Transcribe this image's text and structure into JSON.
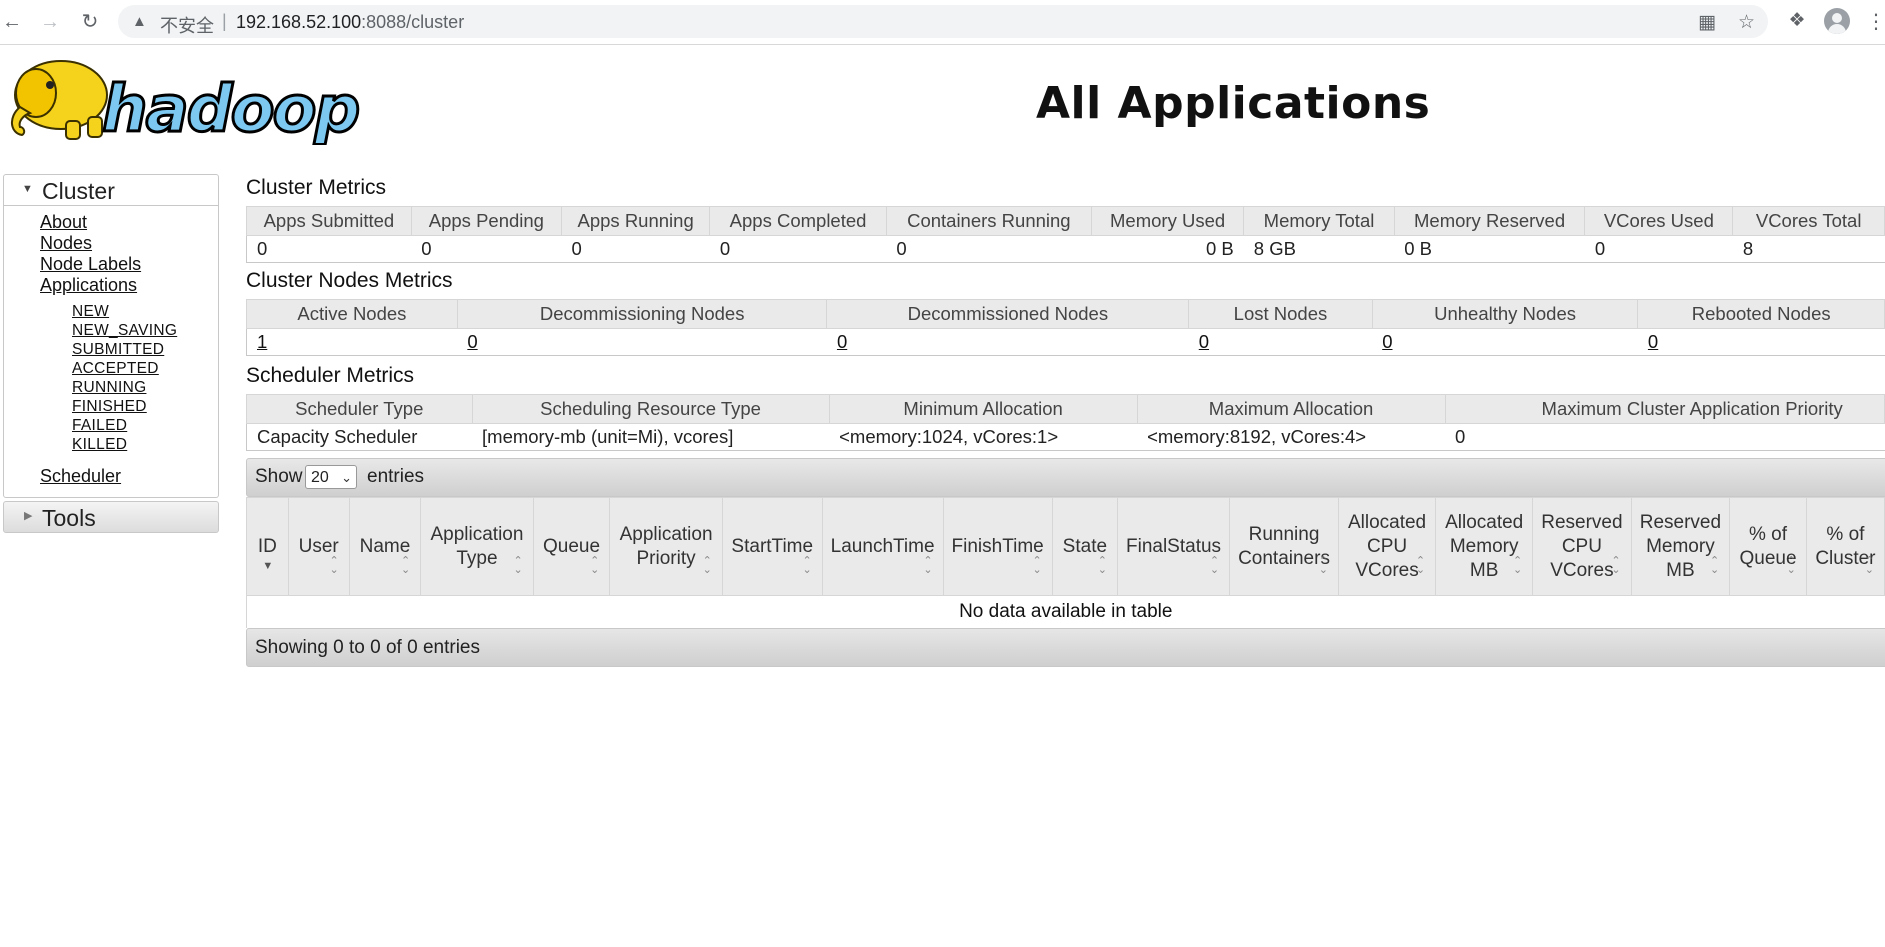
{
  "browser": {
    "insecure_label": "不安全",
    "url_host": "192.168.52.100",
    "url_rest": ":8088/cluster"
  },
  "header": {
    "logo_text": "hadoop",
    "title": "All Applications"
  },
  "sidebar": {
    "cluster_label": "Cluster",
    "links": [
      "About",
      "Nodes",
      "Node Labels",
      "Applications"
    ],
    "app_states": [
      "NEW",
      "NEW_SAVING",
      "SUBMITTED",
      "ACCEPTED",
      "RUNNING",
      "FINISHED",
      "FAILED",
      "KILLED"
    ],
    "scheduler_label": "Scheduler",
    "tools_label": "Tools"
  },
  "cluster_metrics": {
    "title": "Cluster Metrics",
    "headers": [
      "Apps Submitted",
      "Apps Pending",
      "Apps Running",
      "Apps Completed",
      "Containers Running",
      "Memory Used",
      "Memory Total",
      "Memory Reserved",
      "VCores Used",
      "VCores Total"
    ],
    "values": [
      "0",
      "0",
      "0",
      "0",
      "0",
      "0 B",
      "8 GB",
      "0 B",
      "0",
      "8"
    ]
  },
  "nodes_metrics": {
    "title": "Cluster Nodes Metrics",
    "headers": [
      "Active Nodes",
      "Decommissioning Nodes",
      "Decommissioned Nodes",
      "Lost Nodes",
      "Unhealthy Nodes",
      "Rebooted Nodes"
    ],
    "values": [
      "1",
      "0",
      "0",
      "0",
      "0",
      "0"
    ]
  },
  "scheduler_metrics": {
    "title": "Scheduler Metrics",
    "headers": [
      "Scheduler Type",
      "Scheduling Resource Type",
      "Minimum Allocation",
      "Maximum Allocation",
      "Maximum Cluster Application Priority"
    ],
    "values": [
      "Capacity Scheduler",
      "[memory-mb (unit=Mi), vcores]",
      "<memory:1024, vCores:1>",
      "<memory:8192, vCores:4>",
      "0"
    ]
  },
  "apps_table": {
    "show_label": "Show",
    "page_size": "20",
    "entries_label": "entries",
    "columns": [
      [
        "ID"
      ],
      [
        "User"
      ],
      [
        "Name"
      ],
      [
        "Application",
        "Type"
      ],
      [
        "Queue"
      ],
      [
        "Application",
        "Priority"
      ],
      [
        "StartTime"
      ],
      [
        "LaunchTime"
      ],
      [
        "FinishTime"
      ],
      [
        "State"
      ],
      [
        "FinalStatus"
      ],
      [
        "Running",
        "Containers"
      ],
      [
        "Allocated",
        "CPU",
        "VCores"
      ],
      [
        "Allocated",
        "Memory",
        "MB"
      ],
      [
        "Reserved",
        "CPU",
        "VCores"
      ],
      [
        "Reserved",
        "Memory",
        "MB"
      ],
      [
        "% of",
        "Queue"
      ],
      [
        "% of",
        "Cluster"
      ]
    ],
    "empty_message": "No data available in table",
    "info": "Showing 0 to 0 of 0 entries"
  }
}
